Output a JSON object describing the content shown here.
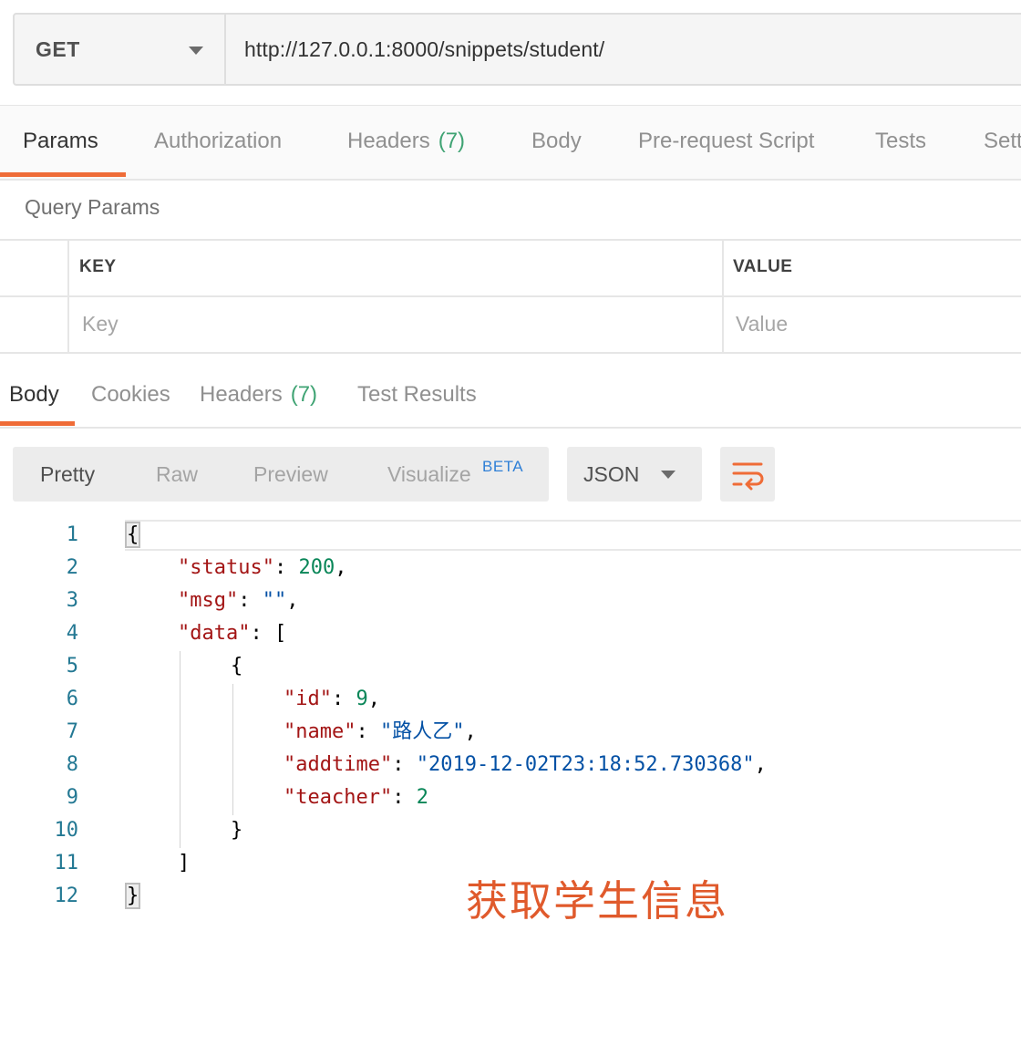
{
  "request": {
    "method": "GET",
    "url": "http://127.0.0.1:8000/snippets/student/"
  },
  "request_tabs": [
    {
      "label": "Params",
      "count": ""
    },
    {
      "label": "Authorization",
      "count": ""
    },
    {
      "label": "Headers",
      "count": "(7)"
    },
    {
      "label": "Body",
      "count": ""
    },
    {
      "label": "Pre-request Script",
      "count": ""
    },
    {
      "label": "Tests",
      "count": ""
    },
    {
      "label": "Sett",
      "count": ""
    }
  ],
  "query_params": {
    "title": "Query Params",
    "columns": [
      "KEY",
      "VALUE"
    ],
    "placeholders": [
      "Key",
      "Value"
    ]
  },
  "response_tabs": [
    {
      "label": "Body",
      "count": ""
    },
    {
      "label": "Cookies",
      "count": ""
    },
    {
      "label": "Headers",
      "count": "(7)"
    },
    {
      "label": "Test Results",
      "count": ""
    }
  ],
  "view_modes": [
    "Pretty",
    "Raw",
    "Preview",
    "Visualize"
  ],
  "beta_badge": "BETA",
  "format": "JSON",
  "icons": {
    "wrap": "wrap-lines-icon",
    "method_dropdown": "chevron-down-icon",
    "format_dropdown": "chevron-down-icon"
  },
  "colors": {
    "accent": "#ef6c37",
    "count": "#3fa373",
    "annotation": "#e05a2c"
  },
  "line_numbers": [
    "1",
    "2",
    "3",
    "4",
    "5",
    "6",
    "7",
    "8",
    "9",
    "10",
    "11",
    "12"
  ],
  "json_response": {
    "status_key": "\"status\"",
    "status_val": "200",
    "msg_key": "\"msg\"",
    "msg_val": "\"\"",
    "data_key": "\"data\"",
    "id_key": "\"id\"",
    "id_val": "9",
    "name_key": "\"name\"",
    "name_val": "\"路人乙\"",
    "addtime_key": "\"addtime\"",
    "addtime_val": "\"2019-12-02T23:18:52.730368\"",
    "teacher_key": "\"teacher\"",
    "teacher_val": "2"
  },
  "annotation": "获取学生信息"
}
